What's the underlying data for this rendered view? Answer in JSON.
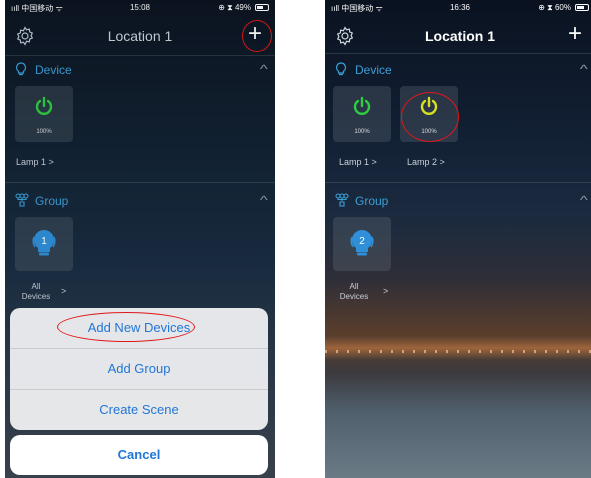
{
  "left": {
    "status": {
      "carrier": "ııll 中国移动 ᯤ",
      "time": "15:08",
      "battery": "⊕ ⧗ 49%"
    },
    "nav": {
      "title": "Location 1"
    },
    "device_section": {
      "title": "Device"
    },
    "device": {
      "pct": "100%",
      "label": "Lamp 1  >"
    },
    "group_section": {
      "title": "Group"
    },
    "group": {
      "num": "1",
      "label": "All\nDevices",
      "arrow": ">"
    },
    "sheet": {
      "items": [
        {
          "label": "Add New Devices"
        },
        {
          "label": "Add Group"
        },
        {
          "label": "Create Scene"
        }
      ],
      "cancel_label": "Cancel"
    }
  },
  "right": {
    "status": {
      "carrier": "ııll 中国移动 ᯤ",
      "time": "16:36",
      "battery": "⊕ ⧗ 60%"
    },
    "nav": {
      "title": "Location 1"
    },
    "device_section": {
      "title": "Device"
    },
    "devices": [
      {
        "pct": "100%",
        "label": "Lamp 1  >"
      },
      {
        "pct": "100%",
        "label": "Lamp 2  >"
      }
    ],
    "group_section": {
      "title": "Group"
    },
    "group": {
      "num": "2",
      "label": "All\nDevices",
      "arrow": ">"
    }
  },
  "colors": {
    "accent": "#3a9fd6",
    "power_green": "#2ecc40",
    "power_yellow": "#d8e020",
    "highlight_red": "#e01818",
    "sheet_text": "#2176d8"
  },
  "icons": {
    "settings": "gear-icon",
    "add": "plus-icon",
    "device": "bulb-outline-icon",
    "group": "group-icon",
    "collapse": "chevron-up-icon",
    "power": "power-icon"
  }
}
